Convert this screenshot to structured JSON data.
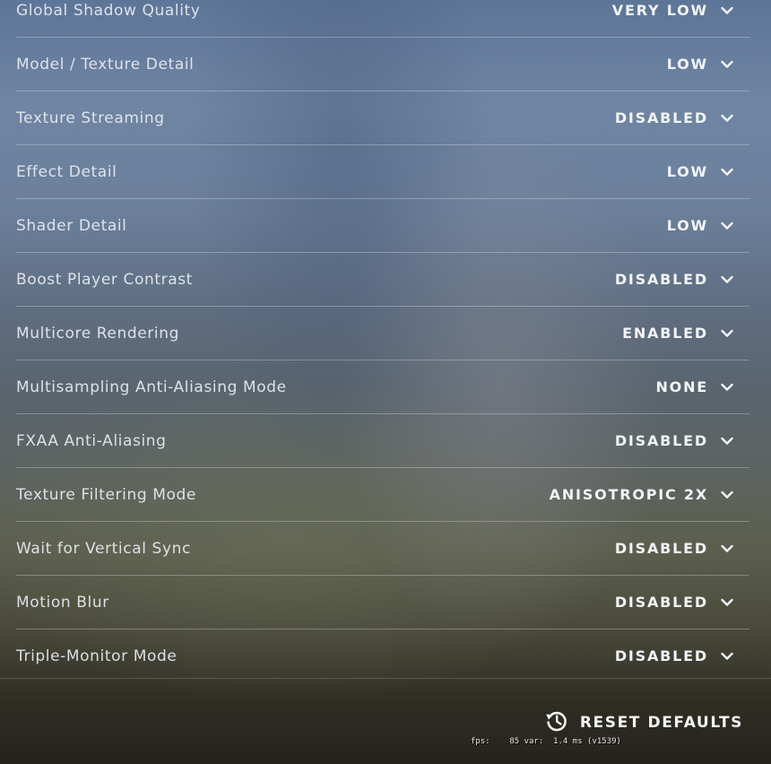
{
  "settings": [
    {
      "label": "Global Shadow Quality",
      "value": "VERY LOW"
    },
    {
      "label": "Model / Texture Detail",
      "value": "LOW"
    },
    {
      "label": "Texture Streaming",
      "value": "DISABLED"
    },
    {
      "label": "Effect Detail",
      "value": "LOW"
    },
    {
      "label": "Shader Detail",
      "value": "LOW"
    },
    {
      "label": "Boost Player Contrast",
      "value": "DISABLED"
    },
    {
      "label": "Multicore Rendering",
      "value": "ENABLED"
    },
    {
      "label": "Multisampling Anti-Aliasing Mode",
      "value": "NONE"
    },
    {
      "label": "FXAA Anti-Aliasing",
      "value": "DISABLED"
    },
    {
      "label": "Texture Filtering Mode",
      "value": "ANISOTROPIC 2X"
    },
    {
      "label": "Wait for Vertical Sync",
      "value": "DISABLED"
    },
    {
      "label": "Motion Blur",
      "value": "DISABLED"
    },
    {
      "label": "Triple-Monitor Mode",
      "value": "DISABLED"
    }
  ],
  "footer": {
    "reset_label": "RESET DEFAULTS",
    "reset_icon": "history-icon"
  },
  "fps_readout": "fps:    85 var:  1.4 ms (v1539)",
  "icons": {
    "dropdown": "chevron-down-icon"
  }
}
